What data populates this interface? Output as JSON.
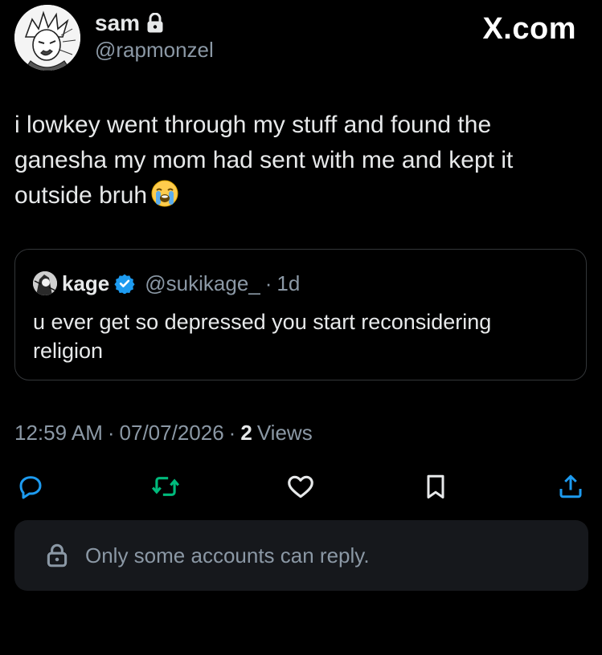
{
  "author": {
    "display_name": "sam",
    "handle": "@rapmonzel",
    "protected": true,
    "avatar_icon": "manga-avatar"
  },
  "brand": "X.com",
  "post": {
    "text": "i lowkey went through my stuff and found the ganesha my mom had sent with me and kept it outside bruh",
    "emoji": "loudly-crying-face"
  },
  "quoted_post": {
    "display_name": "kage",
    "verified": true,
    "handle": "@sukikage_",
    "separator": "·",
    "time": "1d",
    "text": "u ever get so depressed you start reconsidering religion"
  },
  "meta": {
    "time": "12:59 AM",
    "sep1": "·",
    "date": "07/07/2026",
    "sep2": "·",
    "views_count": "2",
    "views_label": "Views"
  },
  "actions": [
    {
      "name": "reply",
      "icon": "reply-icon"
    },
    {
      "name": "repost",
      "icon": "repost-icon"
    },
    {
      "name": "like",
      "icon": "heart-icon"
    },
    {
      "name": "bookmark",
      "icon": "bookmark-icon"
    },
    {
      "name": "share",
      "icon": "share-icon"
    }
  ],
  "reply_restriction": {
    "icon": "lock-icon",
    "text": "Only some accounts can reply."
  },
  "colors": {
    "background": "#000000",
    "text_primary": "#e7e9ea",
    "text_secondary": "#8b98a5",
    "border": "#333639",
    "verified": "#1d9bf0",
    "repost_green": "#00ba7c",
    "reply_bar_bg": "#16181c"
  }
}
